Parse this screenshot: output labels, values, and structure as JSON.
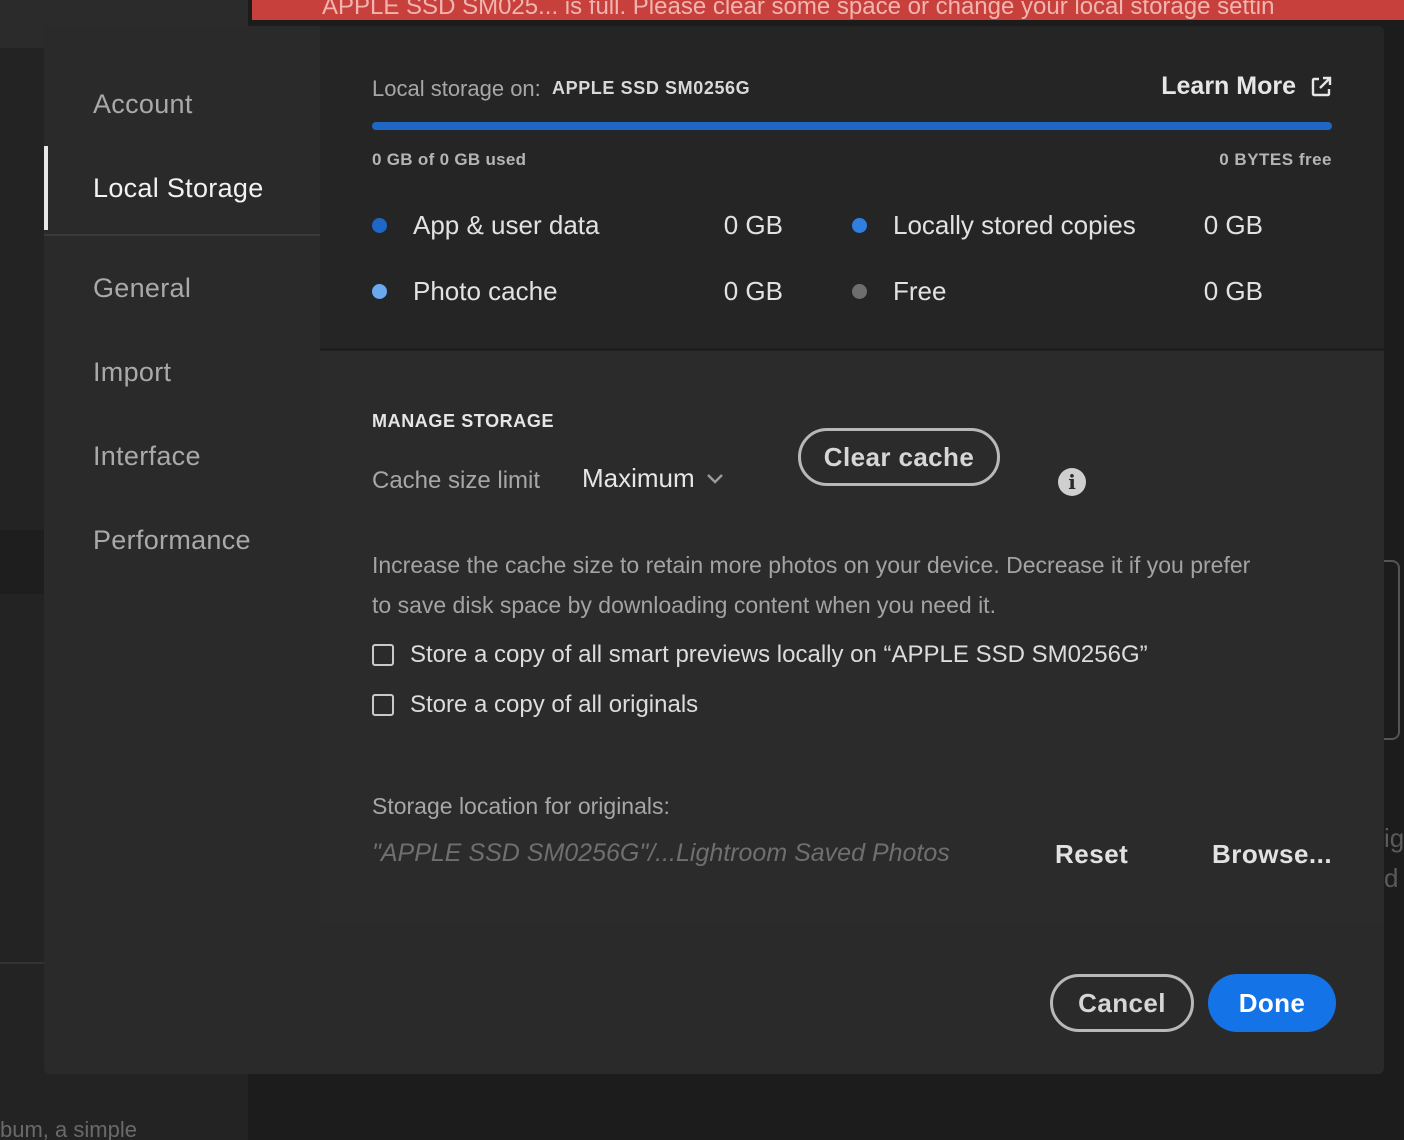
{
  "background": {
    "banner_text": "APPLE SSD SM025...  is full. Please clear some space or change your local storage settin",
    "bottom_text": "bum, a simple",
    "right_text": "ig d"
  },
  "sidebar": {
    "items": [
      {
        "label": "Account"
      },
      {
        "label": "Local Storage",
        "active": true
      },
      {
        "label": "General"
      },
      {
        "label": "Import"
      },
      {
        "label": "Interface"
      },
      {
        "label": "Performance"
      }
    ]
  },
  "storage": {
    "label": "Local storage on:",
    "drive": "APPLE SSD SM0256G",
    "learn_more": "Learn More",
    "learn_more_icon": "external-link-icon",
    "used_text": "0 GB of 0 GB used",
    "free_text": "0 BYTES free",
    "usage_percent": 100,
    "bar_color": "#1e67c7",
    "legend": [
      {
        "label": "App & user data",
        "value": "0 GB",
        "color": "#1e67c7"
      },
      {
        "label": "Locally stored copies",
        "value": "0 GB",
        "color": "#2f7fe0"
      },
      {
        "label": "Photo cache",
        "value": "0 GB",
        "color": "#6aa8f0"
      },
      {
        "label": "Free",
        "value": "0 GB",
        "color": "#6e6e6e"
      }
    ]
  },
  "manage": {
    "title": "MANAGE STORAGE",
    "cache_label": "Cache size limit",
    "cache_value": "Maximum",
    "clear_cache": "Clear cache",
    "info_icon": "info-icon",
    "description": "Increase the cache size to retain more photos on your device. Decrease it if you prefer to save disk space by downloading content when you need it.",
    "checkbox_previews": "Store a copy of all smart previews locally on “APPLE SSD SM0256G”",
    "checkbox_originals": "Store a copy of all originals",
    "location_label": "Storage location for originals:",
    "location_path": "\"APPLE SSD SM0256G\"/...Lightroom Saved Photos",
    "reset": "Reset",
    "browse": "Browse..."
  },
  "footer": {
    "cancel": "Cancel",
    "done": "Done",
    "done_color": "#1473e6"
  }
}
